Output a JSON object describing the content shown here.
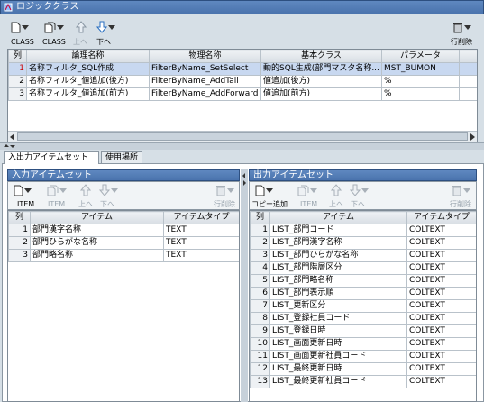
{
  "logic": {
    "title": "ロジッククラス",
    "toolbar": {
      "labels": [
        "CLASS",
        "CLASS",
        "上へ",
        "下へ",
        "行削除"
      ]
    },
    "columns": [
      "列",
      "論理名称",
      "物理名称",
      "基本クラス",
      "パラメータ"
    ],
    "rows": [
      {
        "n": "1",
        "logical": "名称フィルタ_SQL作成",
        "physical": "FilterByName_SetSelect",
        "base": "動的SQL生成(部門マスタ名称...",
        "param": "MST_BUMON"
      },
      {
        "n": "2",
        "logical": "名称フィルタ_値追加(後方)",
        "physical": "FilterByName_AddTail",
        "base": "値追加(後方)",
        "param": "%"
      },
      {
        "n": "3",
        "logical": "名称フィルタ_値追加(前方)",
        "physical": "FilterByName_AddForward",
        "base": "値追加(前方)",
        "param": "%"
      }
    ]
  },
  "tabs": [
    "入出力アイテムセット",
    "使用場所"
  ],
  "input_panel": {
    "title": "入力アイテムセット",
    "labels": [
      "ITEM",
      "ITEM",
      "上へ",
      "下へ",
      "行削除"
    ],
    "columns": [
      "列",
      "アイテム",
      "アイテムタイプ"
    ],
    "rows": [
      {
        "n": "1",
        "item": "部門漢字名称",
        "type": "TEXT"
      },
      {
        "n": "2",
        "item": "部門ひらがな名称",
        "type": "TEXT"
      },
      {
        "n": "3",
        "item": "部門略名称",
        "type": "TEXT"
      }
    ]
  },
  "output_panel": {
    "title": "出力アイテムセット",
    "labels": [
      "コピー追加",
      "ITEM",
      "上へ",
      "下へ",
      "行削除"
    ],
    "columns": [
      "列",
      "アイテム",
      "アイテムタイプ"
    ],
    "rows": [
      {
        "n": "1",
        "item": "LIST_部門コード",
        "type": "COLTEXT"
      },
      {
        "n": "2",
        "item": "LIST_部門漢字名称",
        "type": "COLTEXT"
      },
      {
        "n": "3",
        "item": "LIST_部門ひらがな名称",
        "type": "COLTEXT"
      },
      {
        "n": "4",
        "item": "LIST_部門階層区分",
        "type": "COLTEXT"
      },
      {
        "n": "5",
        "item": "LIST_部門略名称",
        "type": "COLTEXT"
      },
      {
        "n": "6",
        "item": "LIST_部門表示順",
        "type": "COLTEXT"
      },
      {
        "n": "7",
        "item": "LIST_更新区分",
        "type": "COLTEXT"
      },
      {
        "n": "8",
        "item": "LIST_登録社員コード",
        "type": "COLTEXT"
      },
      {
        "n": "9",
        "item": "LIST_登録日時",
        "type": "COLTEXT"
      },
      {
        "n": "10",
        "item": "LIST_画面更新日時",
        "type": "COLTEXT"
      },
      {
        "n": "11",
        "item": "LIST_画面更新社員コード",
        "type": "COLTEXT"
      },
      {
        "n": "12",
        "item": "LIST_最終更新日時",
        "type": "COLTEXT"
      },
      {
        "n": "13",
        "item": "LIST_最終更新社員コード",
        "type": "COLTEXT"
      }
    ]
  },
  "icons": [
    "logic-class-icon",
    "new-doc-icon",
    "copy-doc-icon",
    "up-arrow-icon",
    "down-arrow-icon",
    "trash-icon"
  ]
}
